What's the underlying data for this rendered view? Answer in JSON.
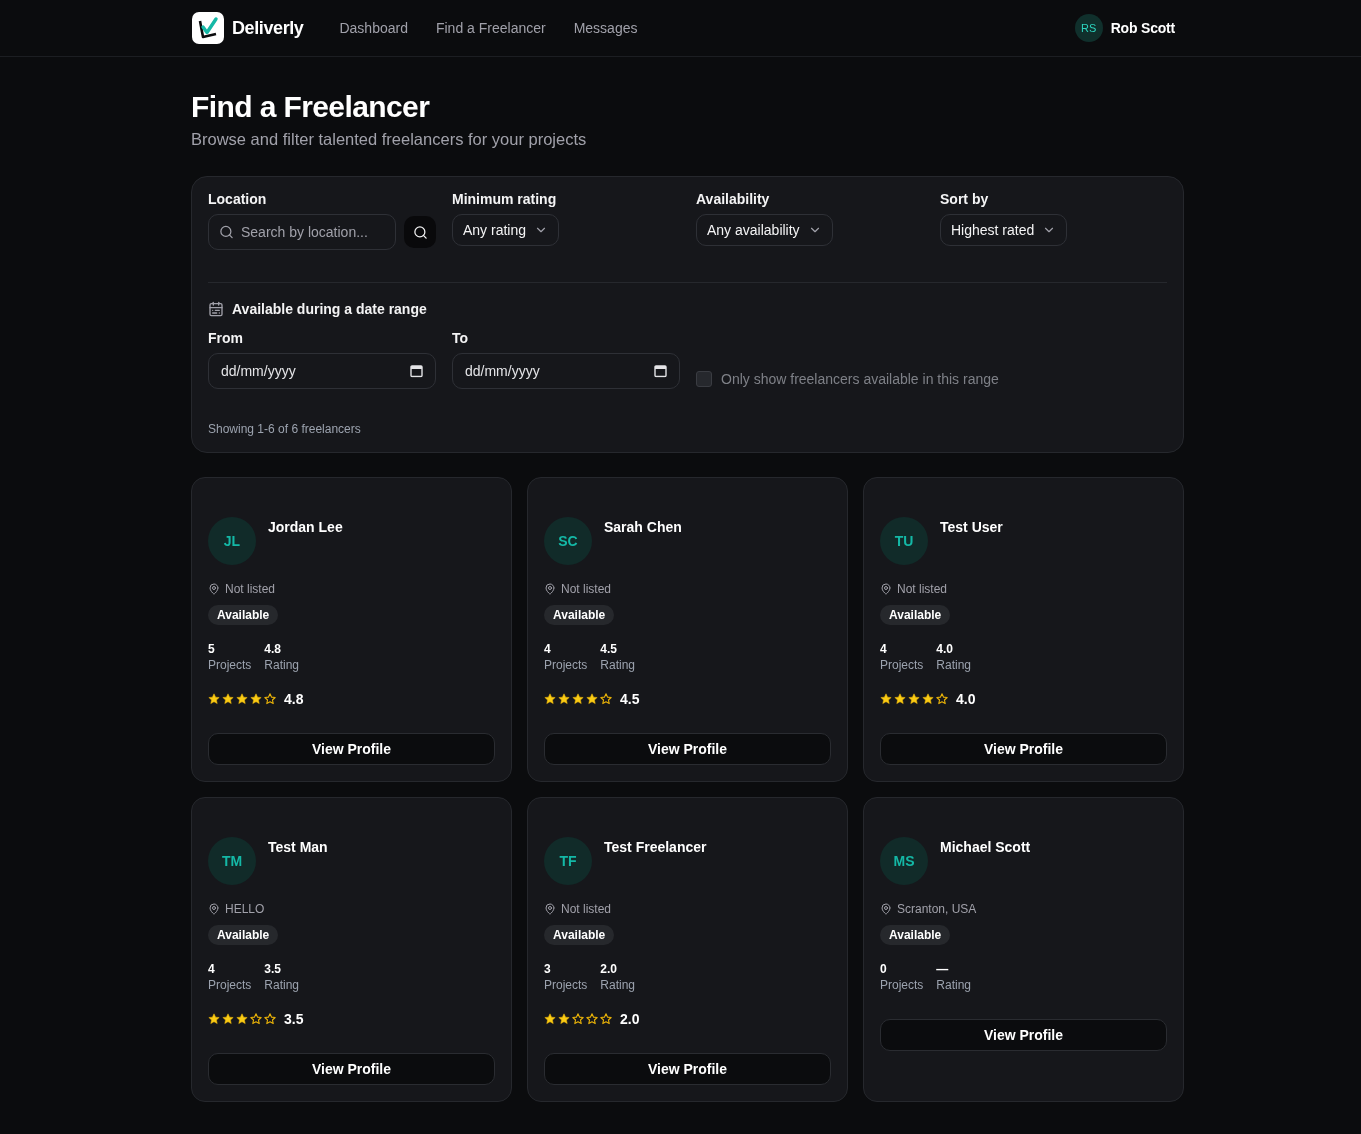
{
  "header": {
    "brand": "Deliverly",
    "nav": [
      {
        "label": "Dashboard",
        "selected": false
      },
      {
        "label": "Find a Freelancer",
        "selected": false
      },
      {
        "label": "Messages",
        "selected": false
      }
    ],
    "user": {
      "initials": "RS",
      "name": "Rob Scott"
    }
  },
  "page": {
    "title": "Find a Freelancer",
    "subtitle": "Browse and filter talented freelancers for your projects"
  },
  "filters": [
    {
      "kind": "search",
      "label": "Location",
      "placeholder": "Search by location..."
    },
    {
      "kind": "select",
      "label": "Minimum rating",
      "value": "Any rating"
    },
    {
      "kind": "select",
      "label": "Availability",
      "value": "Any availability"
    },
    {
      "kind": "select",
      "label": "Sort by",
      "value": "Highest rated"
    }
  ],
  "date_range": {
    "title": "Available during a date range",
    "fields": [
      {
        "label": "From",
        "placeholder": "dd/mm/yyyy"
      },
      {
        "label": "To",
        "placeholder": "dd/mm/yyyy"
      }
    ],
    "only_available": {
      "label": "Only show freelancers available in this range",
      "checked": false,
      "disabled": true
    }
  },
  "results": "Showing 1-6 of 6 freelancers",
  "freelancers": [
    {
      "initials": "JL",
      "name": "Jordan Lee",
      "location": "Not listed",
      "status": "Available",
      "stats": [
        {
          "value": "5",
          "label": "Projects"
        },
        {
          "value": "4.8",
          "label": "Rating"
        }
      ],
      "stars": 4,
      "score": "4.8",
      "button": "View Profile"
    },
    {
      "initials": "SC",
      "name": "Sarah Chen",
      "location": "Not listed",
      "status": "Available",
      "stats": [
        {
          "value": "4",
          "label": "Projects"
        },
        {
          "value": "4.5",
          "label": "Rating"
        }
      ],
      "stars": 4,
      "score": "4.5",
      "button": "View Profile"
    },
    {
      "initials": "TU",
      "name": "Test User",
      "location": "Not listed",
      "status": "Available",
      "stats": [
        {
          "value": "4",
          "label": "Projects"
        },
        {
          "value": "4.0",
          "label": "Rating"
        }
      ],
      "stars": 4,
      "score": "4.0",
      "button": "View Profile"
    },
    {
      "initials": "TM",
      "name": "Test Man",
      "location": "HELLO",
      "status": "Available",
      "stats": [
        {
          "value": "4",
          "label": "Projects"
        },
        {
          "value": "3.5",
          "label": "Rating"
        }
      ],
      "stars": 3,
      "score": "3.5",
      "button": "View Profile"
    },
    {
      "initials": "TF",
      "name": "Test Freelancer",
      "location": "Not listed",
      "status": "Available",
      "stats": [
        {
          "value": "3",
          "label": "Projects"
        },
        {
          "value": "2.0",
          "label": "Rating"
        }
      ],
      "stars": 2,
      "score": "2.0",
      "button": "View Profile"
    },
    {
      "initials": "MS",
      "name": "Michael Scott",
      "location": "Scranton, USA",
      "status": "Available",
      "stats": [
        {
          "value": "0",
          "label": "Projects"
        },
        {
          "value": "—",
          "label": "Rating"
        }
      ],
      "button": "View Profile"
    }
  ]
}
